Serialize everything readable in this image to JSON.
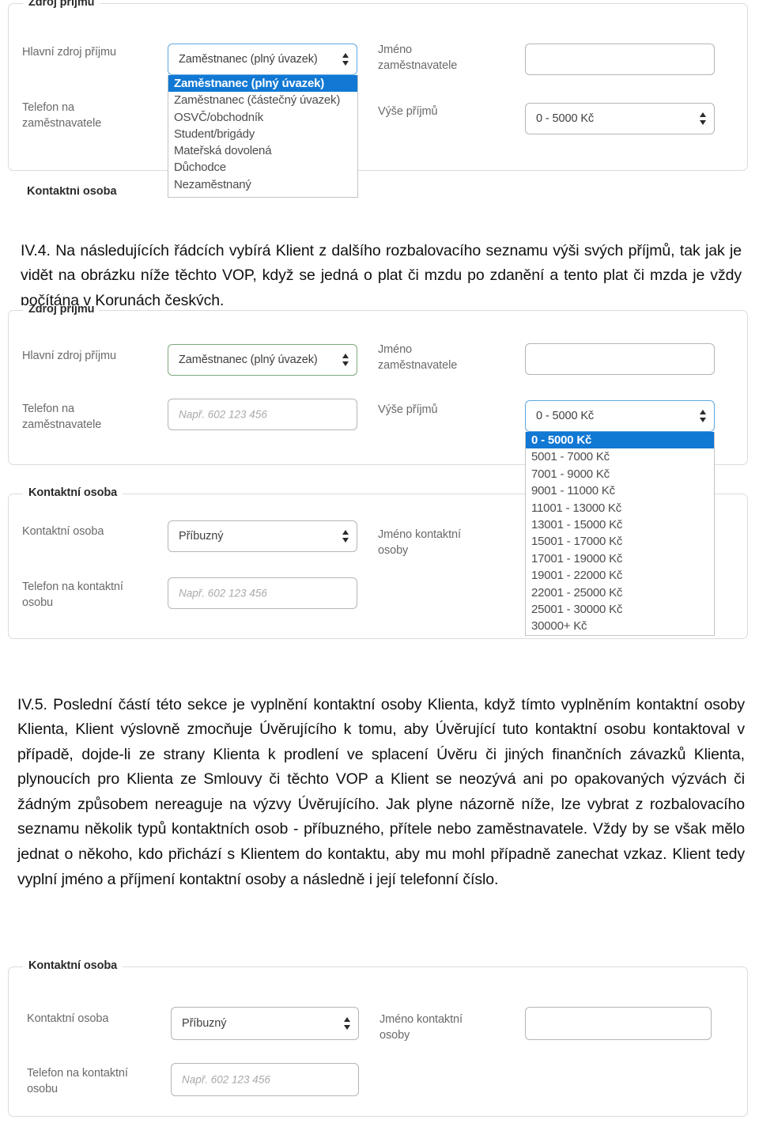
{
  "document": {
    "paragraphs": [
      {
        "id": "IV.4",
        "text": "IV.4. Na následujících řádcích vybírá Klient z dalšího rozbalovacího seznamu výši svých příjmů, tak jak je vidět na obrázku níže těchto VOP, když se jedná o plat či mzdu po zdanění a tento plat či mzda je vždy počítána v Korunách českých."
      },
      {
        "id": "IV.5",
        "text": "IV.5. Poslední částí této sekce je vyplnění kontaktní osoby Klienta, když tímto vyplněním kontaktní osoby Klienta, Klient výslovně zmocňuje Úvěrujícího k tomu, aby Úvěrující tuto kontaktní osobu kontaktoval v případě, dojde-li ze strany Klienta k prodlení ve splacení Úvěru či jiných finančních závazků Klienta, plynoucích pro Klienta ze Smlouvy či těchto VOP a Klient se neozývá ani po opakovaných výzvách či žádným způsobem nereaguje na výzvy Úvěrujícího. Jak plyne názorně níže, lze vybrat z rozbalovacího seznamu několik typů kontaktních osob - příbuzného, přítele nebo zaměstnavatele. Vždy by se však mělo jednat o někoho, kdo přichází s Klientem do kontaktu, aby mu mohl případně zanechat vzkaz. Klient tedy vyplní jméno a příjmení kontaktní osoby a následně i její telefonní číslo."
      }
    ]
  },
  "colors": {
    "highlight_blue": "#1178d4",
    "focus_blue": "#60a8e0",
    "valid_green": "#7ea87e",
    "border_grey": "#b5b5b5",
    "legend_text": "#2b2b2b",
    "label_text": "#6a6a6a"
  },
  "screenshot_top": {
    "fieldset_legend": "Zdroj příjmu",
    "labels": {
      "main_income": "Hlavní zdroj příjmu",
      "employer_phone": "Telefon na\nzaměstnavatele",
      "employer_name": "Jméno\nzaměstnavatele",
      "income_amount": "Výše příjmů"
    },
    "main_income_select": {
      "value": "Zaměstnanec (plný úvazek)",
      "state": "open",
      "options": [
        "Zaměstnanec (plný úvazek)",
        "Zaměstnanec (částečný úvazek)",
        "OSVČ/obchodník",
        "Student/brigády",
        "Mateřská dovolená",
        "Důchodce",
        "Nezaměstnaný"
      ],
      "selected_index": 0
    },
    "employer_name_value": "",
    "income_amount_select": {
      "value": "0 - 5000 Kč"
    },
    "clipped_legend_below": "Kontaktní osoba"
  },
  "screenshot_middle": {
    "fieldset_income_legend": "Zdroj příjmu",
    "fieldset_contact_legend": "Kontaktní osoba",
    "labels": {
      "main_income": "Hlavní zdroj příjmu",
      "employer_phone": "Telefon na\nzaměstnavatele",
      "employer_name": "Jméno\nzaměstnavatele",
      "income_amount": "Výše příjmů",
      "contact_person": "Kontaktní osoba",
      "contact_phone": "Telefon na kontaktní\nosobu",
      "contact_name": "Jméno kontaktní\nosoby"
    },
    "main_income_select": {
      "value": "Zaměstnanec (plný úvazek)",
      "state": "valid"
    },
    "employer_phone_placeholder": "Např. 602 123 456",
    "employer_name_value": "",
    "contact_person_select": {
      "value": "Příbuzný"
    },
    "contact_phone_placeholder": "Např. 602 123 456",
    "income_amount_select": {
      "value": "0 - 5000 Kč",
      "state": "open",
      "options": [
        "0 - 5000 Kč",
        "5001 - 7000 Kč",
        "7001 - 9000 Kč",
        "9001 - 11000 Kč",
        "11001 - 13000 Kč",
        "13001 - 15000 Kč",
        "15001 - 17000 Kč",
        "17001 - 19000 Kč",
        "19001 - 22000 Kč",
        "22001 - 25000 Kč",
        "25001 - 30000 Kč",
        "30000+ Kč"
      ],
      "selected_index": 0
    }
  },
  "screenshot_bottom": {
    "fieldset_legend": "Kontaktní osoba",
    "labels": {
      "contact_person": "Kontaktní osoba",
      "contact_phone": "Telefon na kontaktní\nosobu",
      "contact_name": "Jméno kontaktní\nosoby"
    },
    "contact_person_select": {
      "value": "Příbuzný"
    },
    "contact_phone_placeholder": "Např. 602 123 456",
    "contact_name_value": ""
  }
}
